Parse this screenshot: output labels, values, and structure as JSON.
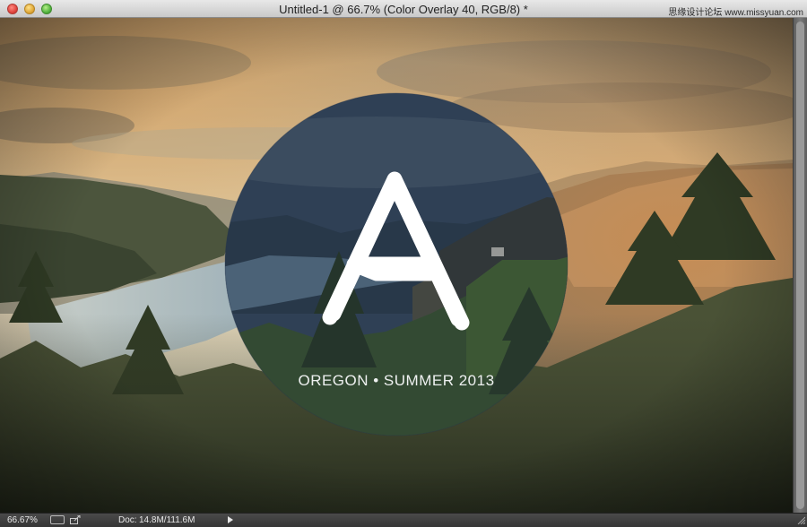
{
  "window": {
    "title": "Untitled-1 @ 66.7% (Color Overlay 40, RGB/8) *",
    "watermark": "思缘设计论坛  www.missyuan.com"
  },
  "artwork": {
    "logo_letter": "A",
    "tagline": "OREGON • SUMMER 2013",
    "colors": {
      "sky_warm": "#d8c39a",
      "overlay_orange": "#d9873a",
      "circle_fill": "#22324a",
      "water": "#8fa7b5",
      "forest_dark": "#2a3a22"
    }
  },
  "statusbar": {
    "zoom": "66.67%",
    "doc_label": "Doc:",
    "doc_value": "14.8M/111.6M",
    "icons": [
      "share-icon",
      "export-icon",
      "menu-arrow-icon"
    ]
  }
}
